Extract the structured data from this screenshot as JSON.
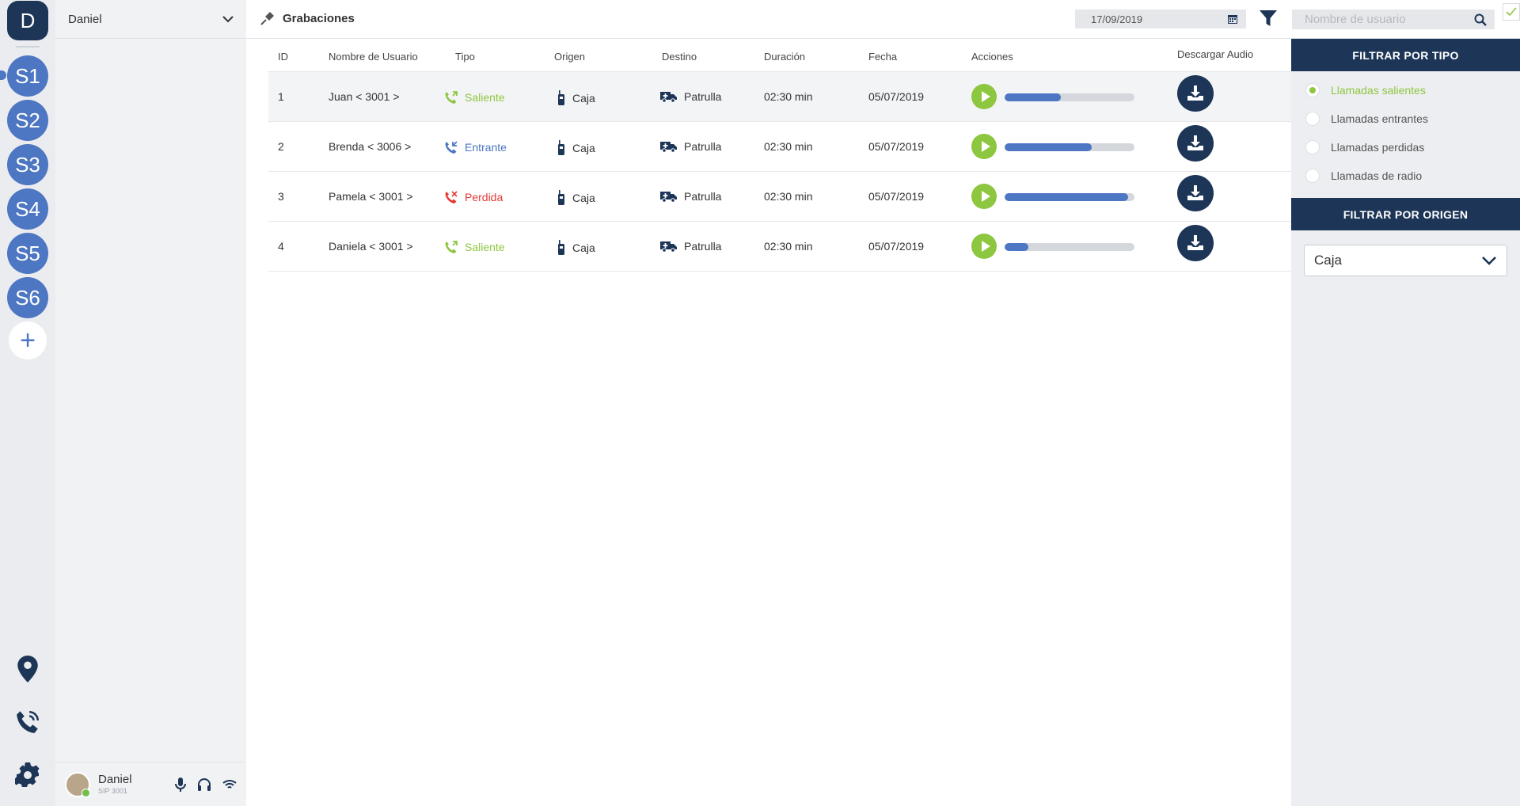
{
  "rail": {
    "profile_initial": "D",
    "servers": [
      "S1",
      "S2",
      "S3",
      "S4",
      "S5",
      "S6"
    ],
    "add_label": "+"
  },
  "workspace": {
    "selector_label": "Daniel"
  },
  "user": {
    "name": "Daniel",
    "sip": "SIP 3001",
    "status": "online"
  },
  "page": {
    "title": "Grabaciones",
    "date_value": "17/09/2019",
    "search_placeholder": "Nombre de usuario"
  },
  "table": {
    "columns": {
      "id": "ID",
      "user": "Nombre de Usuario",
      "type": "Tipo",
      "origin": "Origen",
      "destination": "Destino",
      "duration": "Duración",
      "date": "Fecha",
      "actions": "Acciones",
      "download": "Descargar Audio"
    },
    "rows": [
      {
        "id": "1",
        "user": "Juan < 3001 >",
        "type": "Saliente",
        "origin": "Caja",
        "destination": "Patrulla",
        "duration": "02:30 min",
        "date": "05/07/2019",
        "progress": 0.43
      },
      {
        "id": "2",
        "user": "Brenda < 3006 >",
        "type": "Entrante",
        "origin": "Caja",
        "destination": "Patrulla",
        "duration": "02:30 min",
        "date": "05/07/2019",
        "progress": 0.67
      },
      {
        "id": "3",
        "user": "Pamela < 3001 >",
        "type": "Perdida",
        "origin": "Caja",
        "destination": "Patrulla",
        "duration": "02:30 min",
        "date": "05/07/2019",
        "progress": 0.95
      },
      {
        "id": "4",
        "user": "Daniela < 3001 >",
        "type": "Saliente",
        "origin": "Caja",
        "destination": "Patrulla",
        "duration": "02:30 min",
        "date": "05/07/2019",
        "progress": 0.18
      }
    ]
  },
  "filters": {
    "type_title": "FILTRAR POR TIPO",
    "type_options": [
      {
        "label": "Llamadas salientes",
        "selected": true
      },
      {
        "label": "Llamadas entrantes",
        "selected": false
      },
      {
        "label": "Llamadas perdidas",
        "selected": false
      },
      {
        "label": "Llamadas de radio",
        "selected": false
      }
    ],
    "origin_title": "FILTRAR POR ORIGEN",
    "origin_selected": "Caja"
  },
  "colors": {
    "navy": "#1d3557",
    "blue": "#4d76c3",
    "green": "#8dc63f",
    "red": "#e53935"
  }
}
